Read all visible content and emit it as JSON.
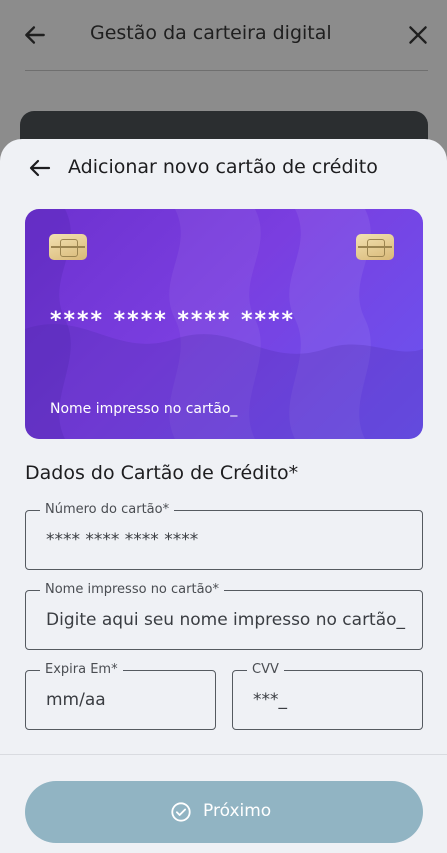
{
  "background_page": {
    "title": "Gestão da carteira digital",
    "back_icon": "arrow-left-icon",
    "close_icon": "close-icon"
  },
  "sheet": {
    "title": "Adicionar novo cartão de crédito",
    "back_icon": "arrow-left-icon"
  },
  "card_preview": {
    "number": "**** **** **** ****",
    "name": "Nome impresso no cartão_",
    "chip_icon": "card-chip-icon",
    "gradient_colors": [
      "#6d31cf",
      "#6a55f0"
    ]
  },
  "form": {
    "section_title": "Dados do Cartão de Crédito*",
    "card_number": {
      "label": "Número do cartão*",
      "value": "**** **** **** ****"
    },
    "printed_name": {
      "label": "Nome impresso no cartão*",
      "value": "Digite aqui seu nome impresso no cartão_"
    },
    "expiry": {
      "label": "Expira Em*",
      "value": "mm/aa"
    },
    "cvv": {
      "label": "CVV",
      "value": "***_"
    }
  },
  "footer": {
    "next_label": "Próximo",
    "next_icon": "check-circle-icon",
    "button_color": "#91b4c3"
  }
}
